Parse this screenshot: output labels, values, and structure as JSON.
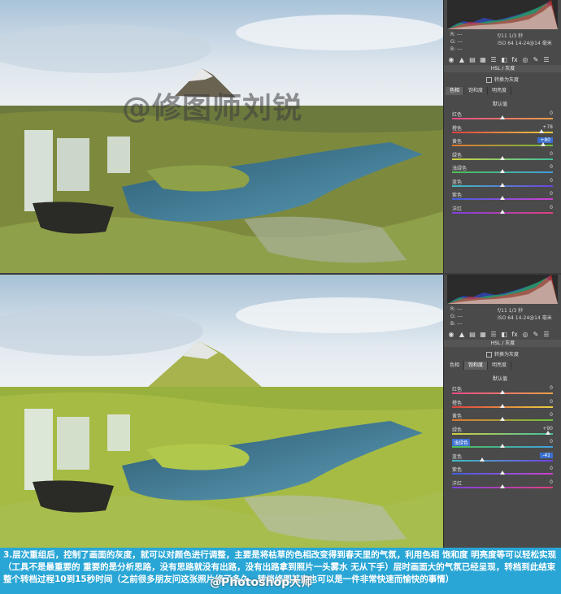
{
  "watermark": "@修图师刘锐",
  "credit": "@Photoshop大师",
  "caption": "3.层次重组后，控制了画面的灰度，就可以对颜色进行调整，主要是将枯草的色相改变得到春天里的气氛，利用色相 饱和度 明亮度等可以轻松实现（工具不是最重要的 重要的是分析思路，没有思路就没有出路，没有出路拿到照片一头雾水 无从下手）层时画面大的气氛已经呈现，转档到此结束 整个转档过程10到15秒时间（之前很多朋友问这张照片修了多久，转档修图其实也可以是一件非常快速而愉快的事情）",
  "panels": [
    {
      "readout": {
        "r": "R:  ---",
        "g": "G:  ---",
        "b": "B:  ---",
        "line1": "f/11    1/3 秒",
        "line2": "ISO 64   14-24@14 毫米"
      },
      "section_title": "HSL / 灰度",
      "grayscale_label": "转换为灰度",
      "tabs": [
        "色相",
        "饱和度",
        "明亮度"
      ],
      "active_tab": 0,
      "default_label": "默认值",
      "sliders": [
        {
          "label": "红色",
          "value": "0",
          "pos": 0.5,
          "selected": false
        },
        {
          "label": "橙色",
          "value": "+78",
          "pos": 0.89,
          "selected": false
        },
        {
          "label": "黄色",
          "value": "+80",
          "pos": 0.9,
          "selected": true
        },
        {
          "label": "绿色",
          "value": "0",
          "pos": 0.5,
          "selected": false
        },
        {
          "label": "浅绿色",
          "value": "0",
          "pos": 0.5,
          "selected": false
        },
        {
          "label": "蓝色",
          "value": "0",
          "pos": 0.5,
          "selected": false
        },
        {
          "label": "紫色",
          "value": "0",
          "pos": 0.5,
          "selected": false
        },
        {
          "label": "洋红",
          "value": "0",
          "pos": 0.5,
          "selected": false
        }
      ]
    },
    {
      "readout": {
        "r": "R:  ---",
        "g": "G:  ---",
        "b": "B:  ---",
        "line1": "f/11    1/3 秒",
        "line2": "ISO 64   14-24@14 毫米"
      },
      "section_title": "HSL / 灰度",
      "grayscale_label": "转换为灰度",
      "tabs": [
        "色相",
        "饱和度",
        "明亮度"
      ],
      "active_tab": 1,
      "default_label": "默认值",
      "sliders": [
        {
          "label": "红色",
          "value": "0",
          "pos": 0.5,
          "selected": false
        },
        {
          "label": "橙色",
          "value": "0",
          "pos": 0.5,
          "selected": false
        },
        {
          "label": "黄色",
          "value": "0",
          "pos": 0.5,
          "selected": false
        },
        {
          "label": "绿色",
          "value": "+90",
          "pos": 0.95,
          "selected": false
        },
        {
          "label": "浅绿色",
          "value": "0",
          "pos": 0.5,
          "selected": true
        },
        {
          "label": "蓝色",
          "value": "-41",
          "pos": 0.3,
          "selected": true
        },
        {
          "label": "紫色",
          "value": "0",
          "pos": 0.5,
          "selected": false
        },
        {
          "label": "洋红",
          "value": "0",
          "pos": 0.5,
          "selected": false
        }
      ]
    }
  ],
  "slider_gradients": [
    [
      "#e84a8a",
      "#e8a04a"
    ],
    [
      "#e04040",
      "#e8d040"
    ],
    [
      "#e07a30",
      "#70c040"
    ],
    [
      "#d0d040",
      "#40c0a0"
    ],
    [
      "#50c050",
      "#40a0e0"
    ],
    [
      "#40c0c0",
      "#7040e0"
    ],
    [
      "#4060e0",
      "#d040d0"
    ],
    [
      "#8040e0",
      "#e04080"
    ]
  ]
}
